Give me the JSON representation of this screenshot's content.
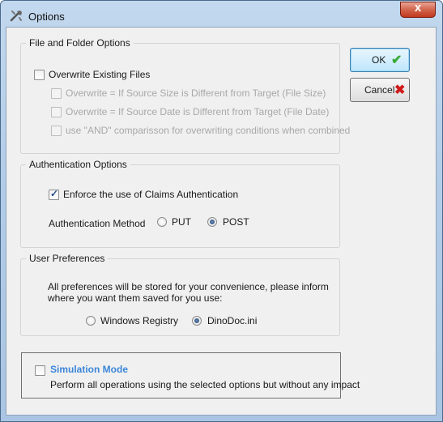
{
  "window": {
    "title": "Options",
    "close_label": "x",
    "icon": "tools-icon"
  },
  "buttons": {
    "ok_label": "OK",
    "ok_icon": "checkmark-icon",
    "ok_icon_color": "#3aa93a",
    "cancel_label": "Cancel",
    "cancel_icon": "red-x-icon",
    "cancel_icon_color": "#d01b1b"
  },
  "file_folder": {
    "title": "File and Folder Options",
    "overwrite_existing": {
      "label": "Overwrite Existing Files",
      "checked": false
    },
    "sub_options": [
      {
        "label": "Overwrite = If Source Size is Different from Target (File Size)",
        "checked": false,
        "enabled": false
      },
      {
        "label": "Overwrite = If Source Date is Different from Target (File Date)",
        "checked": false,
        "enabled": false
      },
      {
        "label": "use \"AND\" comparisson for overwriting conditions when combined",
        "checked": false,
        "enabled": false
      }
    ]
  },
  "authentication": {
    "title": "Authentication Options",
    "enforce_claims": {
      "label": "Enforce the use of Claims Authentication",
      "checked": true
    },
    "method_label": "Authentication Method",
    "methods": [
      {
        "label": "PUT",
        "selected": false
      },
      {
        "label": "POST",
        "selected": true
      }
    ]
  },
  "user_prefs": {
    "title": "User Preferences",
    "description_line1": "All preferences will be stored for your convenience, please inform",
    "description_line2": "where you want them saved for you use:",
    "storage_options": [
      {
        "label": "Windows Registry",
        "selected": false
      },
      {
        "label": "DinoDoc.ini",
        "selected": true
      }
    ]
  },
  "simulation": {
    "title": "Simulation Mode",
    "description": "Perform all operations using the selected options but without any impact",
    "checked": false,
    "title_color": "#3b86d9"
  }
}
